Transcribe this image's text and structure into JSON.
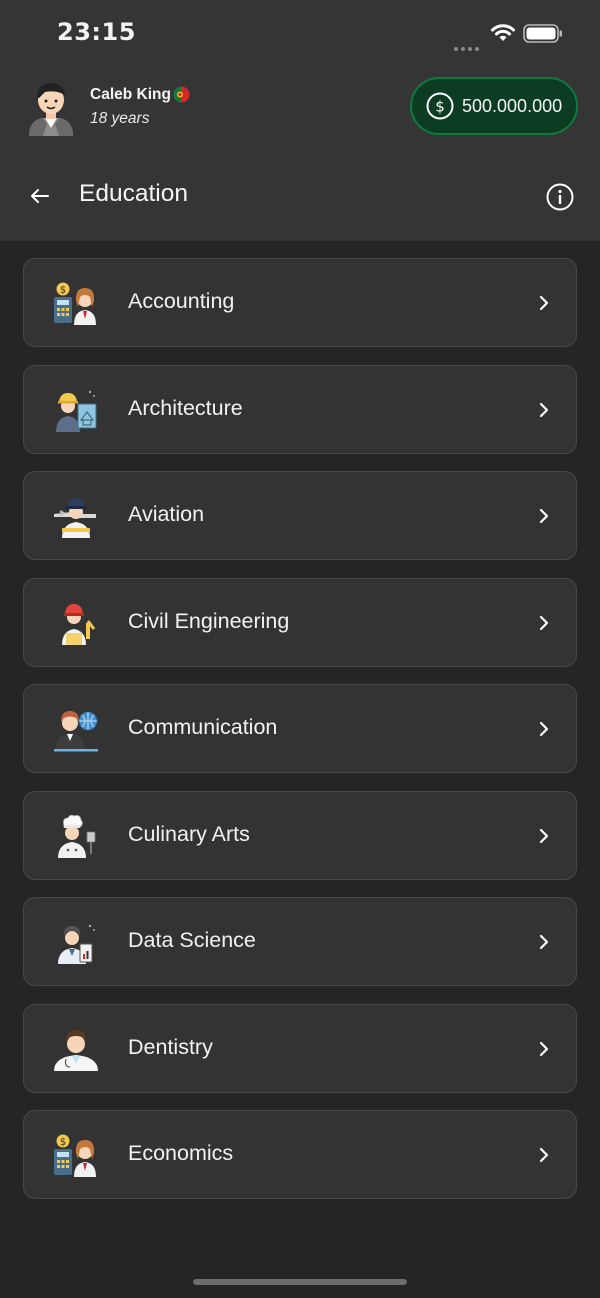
{
  "status_bar": {
    "time": "23:15"
  },
  "profile": {
    "name": "Caleb King",
    "age": "18 years",
    "money": "500.000.000"
  },
  "nav": {
    "title": "Education"
  },
  "courses": [
    {
      "label": "Accounting",
      "icon": "accountant-icon"
    },
    {
      "label": "Architecture",
      "icon": "architect-icon"
    },
    {
      "label": "Aviation",
      "icon": "pilot-icon"
    },
    {
      "label": "Civil Engineering",
      "icon": "engineer-icon"
    },
    {
      "label": "Communication",
      "icon": "communicator-icon"
    },
    {
      "label": "Culinary Arts",
      "icon": "chef-icon"
    },
    {
      "label": "Data Science",
      "icon": "data-scientist-icon"
    },
    {
      "label": "Dentistry",
      "icon": "dentist-icon"
    },
    {
      "label": "Economics",
      "icon": "economist-icon"
    }
  ],
  "colors": {
    "header_bg": "#353535",
    "page_bg": "#252525",
    "card_bg": "#333333",
    "money_bg": "#0c3d22",
    "money_border": "#0e7a3f"
  }
}
